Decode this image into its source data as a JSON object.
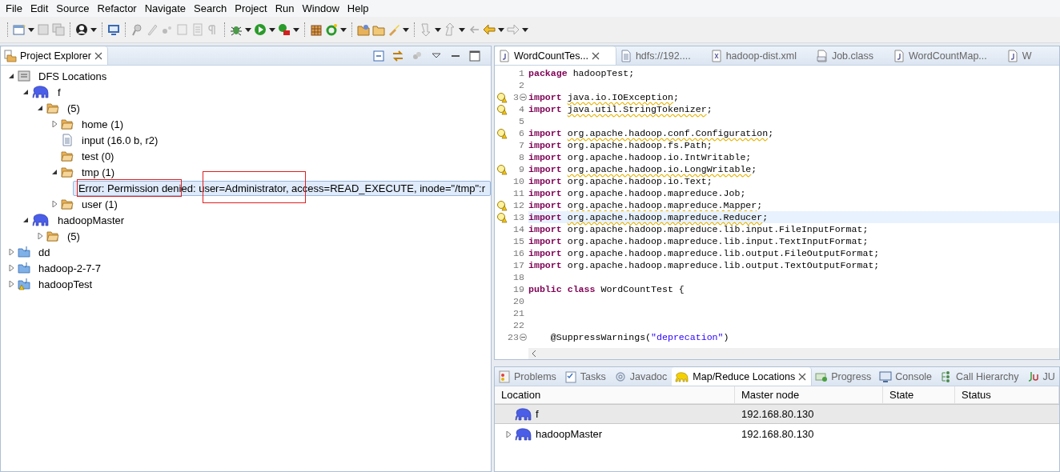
{
  "menu": [
    "File",
    "Edit",
    "Source",
    "Refactor",
    "Navigate",
    "Search",
    "Project",
    "Run",
    "Window",
    "Help"
  ],
  "explorer": {
    "title": "Project Explorer",
    "tree": [
      {
        "kind": "dfs",
        "label": "DFS Locations",
        "expanded": true,
        "selected": false,
        "children": [
          {
            "kind": "location",
            "label": "f",
            "expanded": true,
            "selected": false,
            "children": [
              {
                "kind": "folder",
                "label": "(5)",
                "expanded": true,
                "selected": false,
                "children": [
                  {
                    "kind": "folder",
                    "label": "home (1)",
                    "expanded": false,
                    "selected": false
                  },
                  {
                    "kind": "file",
                    "label": "input (16.0 b, r2)",
                    "selected": false
                  },
                  {
                    "kind": "folder",
                    "label": "test (0)",
                    "selected": false
                  },
                  {
                    "kind": "folder",
                    "label": "tmp (1)",
                    "expanded": true,
                    "selected": false,
                    "children": [
                      {
                        "kind": "error",
                        "label": "Error: Permission denied: user=Administrator, access=READ_EXECUTE, inode=\"/tmp\":r",
                        "selected": true
                      }
                    ]
                  },
                  {
                    "kind": "folder",
                    "label": "user (1)",
                    "expanded": false,
                    "selected": false
                  }
                ]
              }
            ]
          },
          {
            "kind": "location",
            "label": "hadoopMaster",
            "expanded": true,
            "selected": false,
            "children": [
              {
                "kind": "folder",
                "label": "(5)",
                "expanded": false,
                "selected": false
              }
            ]
          }
        ]
      },
      {
        "kind": "project",
        "label": "dd",
        "expanded": false,
        "selected": false
      },
      {
        "kind": "project",
        "label": "hadoop-2-7-7",
        "expanded": false,
        "selected": false
      },
      {
        "kind": "project",
        "label": "hadoopTest",
        "expanded": false,
        "selected": false,
        "warning": true
      }
    ]
  },
  "editor_tabs": [
    {
      "kind": "java",
      "label": "WordCountTes...",
      "selected": true
    },
    {
      "kind": "text",
      "label": "hdfs://192....",
      "selected": false
    },
    {
      "kind": "xml",
      "label": "hadoop-dist.xml",
      "selected": false
    },
    {
      "kind": "class",
      "label": "Job.class",
      "selected": false
    },
    {
      "kind": "java",
      "label": "WordCountMap...",
      "selected": false
    },
    {
      "kind": "java",
      "label": "W",
      "selected": false
    }
  ],
  "code": [
    {
      "number": "1",
      "tokens": [
        {
          "kind": "keyword",
          "text": "package"
        },
        {
          "kind": "plain",
          "text": " hadoopTest;"
        }
      ]
    },
    {
      "number": "2"
    },
    {
      "number": "3",
      "warning": true,
      "fold": true,
      "tokens": [
        {
          "kind": "keyword",
          "text": "import "
        },
        {
          "kind": "warned",
          "text": "java.io.IOException"
        },
        {
          "kind": "plain",
          "text": ";"
        }
      ]
    },
    {
      "number": "4",
      "warning": true,
      "tokens": [
        {
          "kind": "keyword",
          "text": "import "
        },
        {
          "kind": "warned",
          "text": "java.util.StringTokenizer"
        },
        {
          "kind": "plain",
          "text": ";"
        }
      ]
    },
    {
      "number": "5"
    },
    {
      "number": "6",
      "warning": true,
      "tokens": [
        {
          "kind": "keyword",
          "text": "import "
        },
        {
          "kind": "warned",
          "text": "org.apache.hadoop.conf.Configuration"
        },
        {
          "kind": "plain",
          "text": ";"
        }
      ]
    },
    {
      "number": "7",
      "tokens": [
        {
          "kind": "keyword",
          "text": "import"
        },
        {
          "kind": "plain",
          "text": " org.apache.hadoop.fs.Path;"
        }
      ]
    },
    {
      "number": "8",
      "tokens": [
        {
          "kind": "keyword",
          "text": "import"
        },
        {
          "kind": "plain",
          "text": " org.apache.hadoop.io.IntWritable;"
        }
      ]
    },
    {
      "number": "9",
      "warning": true,
      "tokens": [
        {
          "kind": "keyword",
          "text": "import "
        },
        {
          "kind": "warned",
          "text": "org.apache.hadoop.io.LongWritable"
        },
        {
          "kind": "plain",
          "text": ";"
        }
      ]
    },
    {
      "number": "10",
      "tokens": [
        {
          "kind": "keyword",
          "text": "import"
        },
        {
          "kind": "plain",
          "text": " org.apache.hadoop.io.Text;"
        }
      ]
    },
    {
      "number": "11",
      "tokens": [
        {
          "kind": "keyword",
          "text": "import"
        },
        {
          "kind": "plain",
          "text": " org.apache.hadoop.mapreduce.Job;"
        }
      ]
    },
    {
      "number": "12",
      "warning": true,
      "tokens": [
        {
          "kind": "keyword",
          "text": "import "
        },
        {
          "kind": "warned",
          "text": "org.apache.hadoop.mapreduce.Mapper"
        },
        {
          "kind": "plain",
          "text": ";"
        }
      ]
    },
    {
      "number": "13",
      "warning": true,
      "current": true,
      "tokens": [
        {
          "kind": "keyword",
          "text": "import "
        },
        {
          "kind": "warned",
          "text": "org.apache.hadoop.mapreduce.Reducer"
        },
        {
          "kind": "plain",
          "text": ";"
        }
      ]
    },
    {
      "number": "14",
      "tokens": [
        {
          "kind": "keyword",
          "text": "import"
        },
        {
          "kind": "plain",
          "text": " org.apache.hadoop.mapreduce.lib.input.FileInputFormat;"
        }
      ]
    },
    {
      "number": "15",
      "tokens": [
        {
          "kind": "keyword",
          "text": "import"
        },
        {
          "kind": "plain",
          "text": " org.apache.hadoop.mapreduce.lib.input.TextInputFormat;"
        }
      ]
    },
    {
      "number": "16",
      "tokens": [
        {
          "kind": "keyword",
          "text": "import"
        },
        {
          "kind": "plain",
          "text": " org.apache.hadoop.mapreduce.lib.output.FileOutputFormat;"
        }
      ]
    },
    {
      "number": "17",
      "tokens": [
        {
          "kind": "keyword",
          "text": "import"
        },
        {
          "kind": "plain",
          "text": " org.apache.hadoop.mapreduce.lib.output.TextOutputFormat;"
        }
      ]
    },
    {
      "number": "18"
    },
    {
      "number": "19",
      "tokens": [
        {
          "kind": "keyword",
          "text": "public class"
        },
        {
          "kind": "plain",
          "text": " WordCountTest {"
        }
      ]
    },
    {
      "number": "20"
    },
    {
      "number": "21"
    },
    {
      "number": "22"
    },
    {
      "number": "23",
      "fold": true,
      "tokens": [
        {
          "kind": "plain",
          "text": "    @SuppressWarnings("
        },
        {
          "kind": "string",
          "text": "\"deprecation\""
        },
        {
          "kind": "plain",
          "text": ")"
        }
      ]
    }
  ],
  "bottom_tabs": [
    {
      "kind": "problems",
      "label": "Problems",
      "selected": false
    },
    {
      "kind": "tasks",
      "label": "Tasks",
      "selected": false
    },
    {
      "kind": "javadoc",
      "label": "Javadoc",
      "selected": false
    },
    {
      "kind": "mapreduce",
      "label": "Map/Reduce Locations",
      "selected": true
    },
    {
      "kind": "progress",
      "label": "Progress",
      "selected": false
    },
    {
      "kind": "console",
      "label": "Console",
      "selected": false
    },
    {
      "kind": "hierarchy",
      "label": "Call Hierarchy",
      "selected": false
    },
    {
      "kind": "junit",
      "label": "JU",
      "selected": false
    }
  ],
  "locations": {
    "columns": [
      "Location",
      "Master node",
      "State",
      "Status"
    ],
    "rows": [
      {
        "location": "f",
        "master_node": "192.168.80.130",
        "selected": true,
        "expandable": false
      },
      {
        "location": "hadoopMaster",
        "master_node": "192.168.80.130",
        "selected": false,
        "expandable": true
      }
    ]
  }
}
